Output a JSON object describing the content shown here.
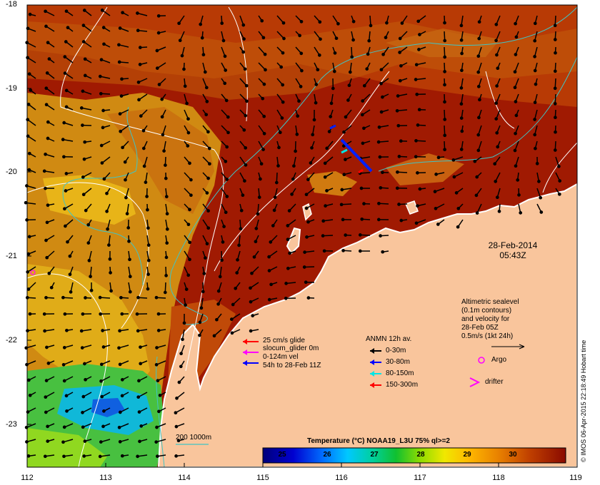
{
  "map": {
    "date_line1": "28-Feb-2014",
    "date_line2": "05:43Z",
    "lat_ticks": [
      "-18",
      "-19",
      "-20",
      "-21",
      "-22",
      "-23"
    ],
    "lon_ticks": [
      "112",
      "113",
      "114",
      "115",
      "116",
      "117",
      "118",
      "119"
    ],
    "credit": "© IMOS 06-Apr-2015 22:18:49 Hobart time",
    "colors": {
      "land": "#f9c59c",
      "warm_sea": "#a01a02",
      "cool_sea": "#d9a31a",
      "contour": "#ffffff",
      "isobath": "#40c4c4"
    }
  },
  "glider_legend": {
    "line1": "25 cm/s glide",
    "line2": "slocum_glider 0m",
    "line3": "0-124m vel",
    "line4": "54h to 28-Feb 11Z"
  },
  "anmn_legend": {
    "title": "ANMN 12h av.",
    "items": [
      {
        "label": "0-30m",
        "color": "#000000"
      },
      {
        "label": "30-80m",
        "color": "#0000ff"
      },
      {
        "label": "80-150m",
        "color": "#00e5e5"
      },
      {
        "label": "150-300m",
        "color": "#ff0000"
      }
    ]
  },
  "altimetry_legend": {
    "line1": "Altimetric sealevel",
    "line2": "(0.1m contours)",
    "line3": "and velocity for",
    "line4": "28-Feb 05Z",
    "line5": "0.5m/s (1kt 24h)",
    "argo": "Argo",
    "drifter": "drifter"
  },
  "isobath_label": "200  1000m",
  "colorbar": {
    "title": "Temperature (°C) NOAA19_L3U 75% ql>=2",
    "ticks": [
      "25",
      "26",
      "27",
      "28",
      "29",
      "30"
    ],
    "colors": [
      "#00007a",
      "#0000c8",
      "#0050ff",
      "#00a8ff",
      "#00e0e0",
      "#00c060",
      "#40d000",
      "#c0e000",
      "#ffe000",
      "#ffb000",
      "#f08000",
      "#d05000",
      "#a01a02",
      "#8a0a00"
    ]
  }
}
